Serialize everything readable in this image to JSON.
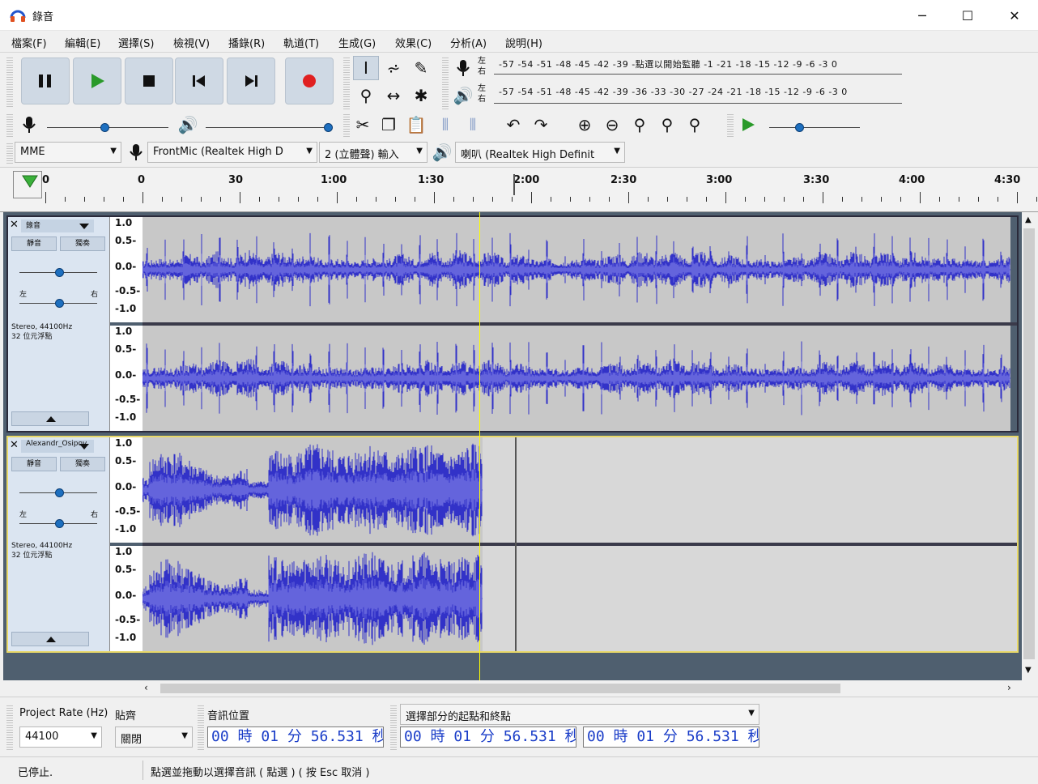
{
  "window": {
    "title": "錄音",
    "minimize": "─",
    "maximize": "☐",
    "close": "✕"
  },
  "menu": [
    "檔案(F)",
    "編輯(E)",
    "選擇(S)",
    "檢視(V)",
    "播錄(R)",
    "軌道(T)",
    "生成(G)",
    "效果(C)",
    "分析(A)",
    "說明(H)"
  ],
  "meters": {
    "record_lr": "左\n右",
    "playback_lr": "左\n右",
    "record_scale": "-57 -54 -51 -48 -45 -42 -39 -點選以開始監聽 -1 -21 -18 -15 -12 -9 -6 -3 0",
    "playback_scale": "-57 -54 -51 -48 -45 -42 -39 -36 -33 -30 -27 -24 -21 -18 -15 -12 -9 -6 -3 0"
  },
  "device": {
    "host": "MME",
    "input": "FrontMic (Realtek High D",
    "channels": "2 (立體聲) 輸入",
    "output": "喇叭 (Realtek High Definit"
  },
  "timeline": {
    "labels": [
      "0",
      "30",
      "1:00",
      "1:30",
      "2:00",
      "2:30",
      "3:00",
      "3:30",
      "4:00",
      "4:30"
    ],
    "first_partial": "0"
  },
  "tracks": [
    {
      "name": "錄音",
      "mute": "靜音",
      "solo": "獨奏",
      "pan_left": "左",
      "pan_right": "右",
      "info1": "Stereo, 44100Hz",
      "info2": "32 位元浮點",
      "scale": [
        "1.0",
        "0.5-",
        "0.0-",
        "-0.5-",
        "-1.0"
      ]
    },
    {
      "name": "Alexandr_Osipov",
      "mute": "靜音",
      "solo": "獨奏",
      "pan_left": "左",
      "pan_right": "右",
      "info1": "Stereo, 44100Hz",
      "info2": "32 位元浮點",
      "scale": [
        "1.0",
        "0.5-",
        "0.0-",
        "-0.5-",
        "-1.0"
      ]
    }
  ],
  "selection": {
    "project_rate_label": "Project Rate (Hz)",
    "project_rate": "44100",
    "snap_label": "貼齊",
    "snap_value": "關閉",
    "audio_position_label": "音訊位置",
    "audio_position": "00 時 01 分 56.531 秒",
    "range_label": "選擇部分的起點和終點",
    "start": "00 時 01 分 56.531 秒",
    "end": "00 時 01 分 56.531 秒"
  },
  "status": {
    "state": "已停止.",
    "hint": "點選並拖動以選擇音訊 ( 點選 ) ( 按 Esc 取消 )"
  },
  "colors": {
    "wave": "#3232c8",
    "wave_light": "#6464dc",
    "cursor": "#ffff00",
    "selected_border": "#f0e060"
  }
}
